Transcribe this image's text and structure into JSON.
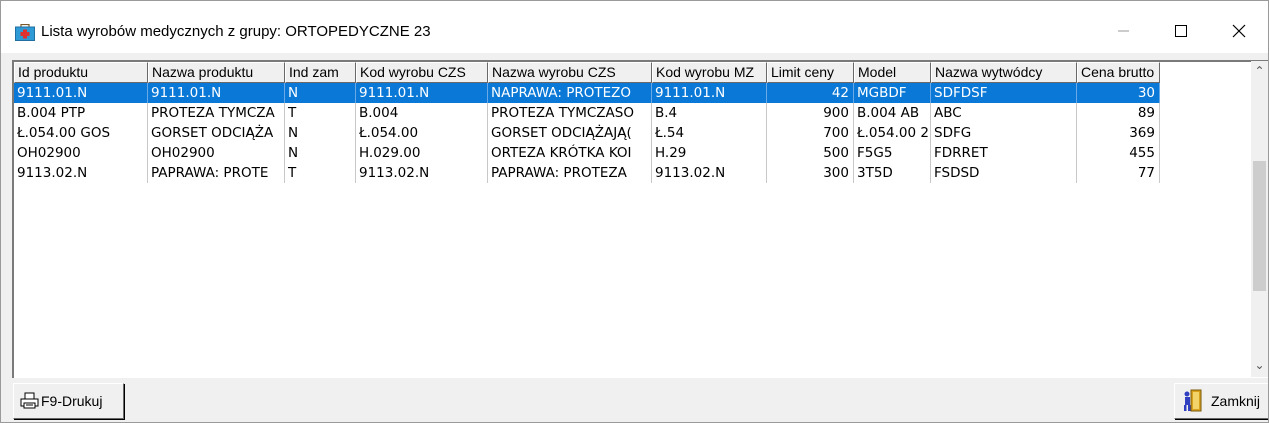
{
  "window": {
    "title": "Lista wyrobów medycznych z grupy: ORTOPEDYCZNE 23",
    "icon": "medical-kit-icon"
  },
  "columns": [
    "Id produktu",
    "Nazwa produktu",
    "Ind zam",
    "Kod wyrobu CZS",
    "Nazwa wyrobu CZS",
    "Kod wyrobu MZ",
    "Limit ceny",
    "Model",
    "Nazwa wytwódcy",
    "Cena brutto"
  ],
  "rows": [
    [
      "9111.01.N",
      "9111.01.N",
      "N",
      "9111.01.N",
      "NAPRAWA: PROTEZO",
      "9111.01.N",
      "42",
      "MGBDF",
      "SDFDSF",
      "30"
    ],
    [
      "B.004 PTP",
      "PROTEZA TYMCZA",
      "T",
      "B.004",
      "PROTEZA TYMCZASO",
      "B.4",
      "900",
      "B.004 AB",
      "ABC",
      "89"
    ],
    [
      "Ł.054.00 GOS",
      "GORSET ODCIĄŻA",
      "N",
      "Ł.054.00",
      "GORSET ODCIĄŻAJĄ(",
      "Ł.54",
      "700",
      "Ł.054.00 2",
      "SDFG",
      "369"
    ],
    [
      "OH02900",
      "OH02900",
      "N",
      "H.029.00",
      "ORTEZA KRÓTKA KOI",
      "H.29",
      "500",
      "F5G5",
      "FDRRET",
      "455"
    ],
    [
      "9113.02.N",
      "PAPRAWA: PROTE",
      "T",
      "9113.02.N",
      "PAPRAWA: PROTEZA",
      "9113.02.N",
      "300",
      "3T5D",
      "FSDSD",
      "77"
    ]
  ],
  "selected_row": 0,
  "buttons": {
    "print_label": "F9-Drukuj",
    "close_label": "Zamknij"
  },
  "colors": {
    "selection": "#0a78d7",
    "selection_text": "#ffffff"
  }
}
